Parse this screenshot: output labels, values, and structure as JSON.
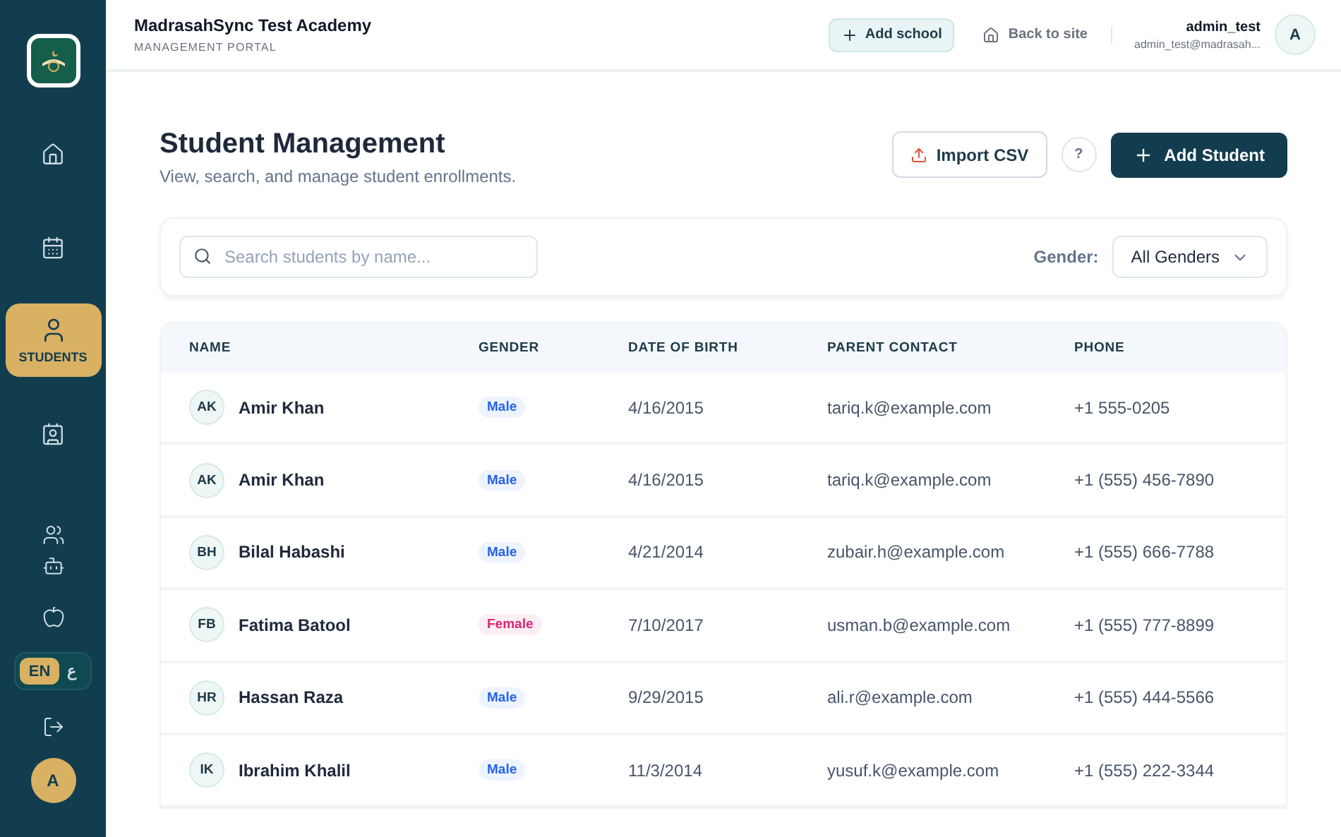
{
  "sidebar": {
    "nav": [
      {
        "selected": false
      },
      {
        "selected": false
      },
      {
        "label": "STUDENTS",
        "selected": true
      },
      {
        "selected": false
      }
    ],
    "tools": [
      {
        "selected": false
      },
      {
        "selected": false
      },
      {
        "selected": false
      }
    ],
    "language": [
      {
        "label": "EN",
        "selected": true
      },
      {
        "label": "ع",
        "selected": false
      }
    ],
    "avatar": "A"
  },
  "header": {
    "title": "MadrasahSync Test Academy",
    "subtitle": "MANAGEMENT PORTAL",
    "add_school": "Add school",
    "back": "Back to site",
    "user": {
      "name": "admin_test",
      "email": "admin_test@madrasah...",
      "avatar": "A"
    }
  },
  "page": {
    "title": "Student Management",
    "subtitle": "View, search, and manage student enrollments.",
    "import": "Import CSV",
    "help": "?",
    "add": "Add Student"
  },
  "filters": {
    "search": {
      "placeholder": "Search students by name..."
    },
    "gender_label": "Gender:",
    "gender_value": "All Genders"
  },
  "table": {
    "columns": [
      "NAME",
      "GENDER",
      "DATE OF BIRTH",
      "PARENT CONTACT",
      "PHONE"
    ],
    "rows": [
      {
        "initials": "AK",
        "name": "Amir Khan",
        "gender": {
          "label": "Male",
          "kind": "male"
        },
        "dob": "4/16/2015",
        "contact": "tariq.k@example.com",
        "phone": "+1 555-0205"
      },
      {
        "initials": "AK",
        "name": "Amir Khan",
        "gender": {
          "label": "Male",
          "kind": "male"
        },
        "dob": "4/16/2015",
        "contact": "tariq.k@example.com",
        "phone": "+1 (555) 456-7890"
      },
      {
        "initials": "BH",
        "name": "Bilal Habashi",
        "gender": {
          "label": "Male",
          "kind": "male"
        },
        "dob": "4/21/2014",
        "contact": "zubair.h@example.com",
        "phone": "+1 (555) 666-7788"
      },
      {
        "initials": "FB",
        "name": "Fatima Batool",
        "gender": {
          "label": "Female",
          "kind": "female"
        },
        "dob": "7/10/2017",
        "contact": "usman.b@example.com",
        "phone": "+1 (555) 777-8899"
      },
      {
        "initials": "HR",
        "name": "Hassan Raza",
        "gender": {
          "label": "Male",
          "kind": "male"
        },
        "dob": "9/29/2015",
        "contact": "ali.r@example.com",
        "phone": "+1 (555) 444-5566"
      },
      {
        "initials": "IK",
        "name": "Ibrahim Khalil",
        "gender": {
          "label": "Male",
          "kind": "male"
        },
        "dob": "11/3/2014",
        "contact": "yusuf.k@example.com",
        "phone": "+1 (555) 222-3344"
      }
    ]
  }
}
